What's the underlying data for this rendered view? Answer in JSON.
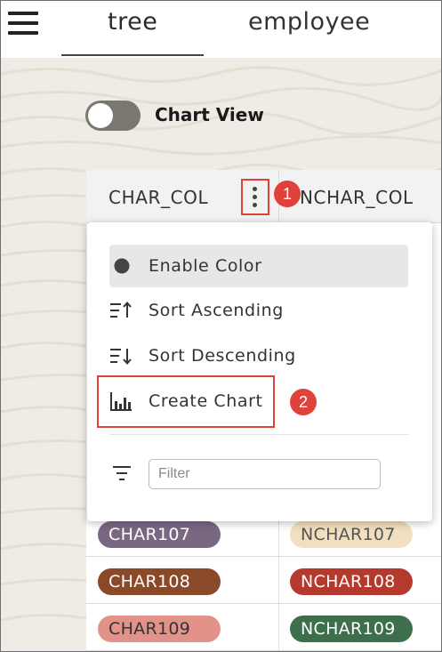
{
  "header": {
    "tabs": [
      {
        "label": "tree",
        "active": true
      },
      {
        "label": "employee",
        "active": false
      }
    ]
  },
  "chart_view": {
    "label": "Chart View",
    "on": false
  },
  "table": {
    "columns": [
      "CHAR_COL",
      "NCHAR_COL"
    ],
    "rows": [
      {
        "char": "CHAR107",
        "char_color": "#7a6883",
        "nchar": "NCHAR107",
        "nchar_color": "#f1dfbf"
      },
      {
        "char": "CHAR108",
        "char_color": "#8a4a2a",
        "nchar": "NCHAR108",
        "nchar_color": "#b53a2d"
      },
      {
        "char": "CHAR109",
        "char_color": "#e3928a",
        "nchar": "NCHAR109",
        "nchar_color": "#3d6f4c"
      }
    ]
  },
  "menu": {
    "items": [
      {
        "label": "Enable Color",
        "icon": "dot-icon",
        "active": true
      },
      {
        "label": "Sort Ascending",
        "icon": "sort-ascending-icon",
        "active": false
      },
      {
        "label": "Sort Descending",
        "icon": "sort-descending-icon",
        "active": false
      },
      {
        "label": "Create Chart",
        "icon": "bar-chart-icon",
        "active": false
      }
    ],
    "filter_placeholder": "Filter"
  },
  "annotations": [
    "1",
    "2"
  ],
  "colors": {
    "annotation": "#e0413b",
    "toggle_track": "#7a7670",
    "background": "#eeece4"
  }
}
